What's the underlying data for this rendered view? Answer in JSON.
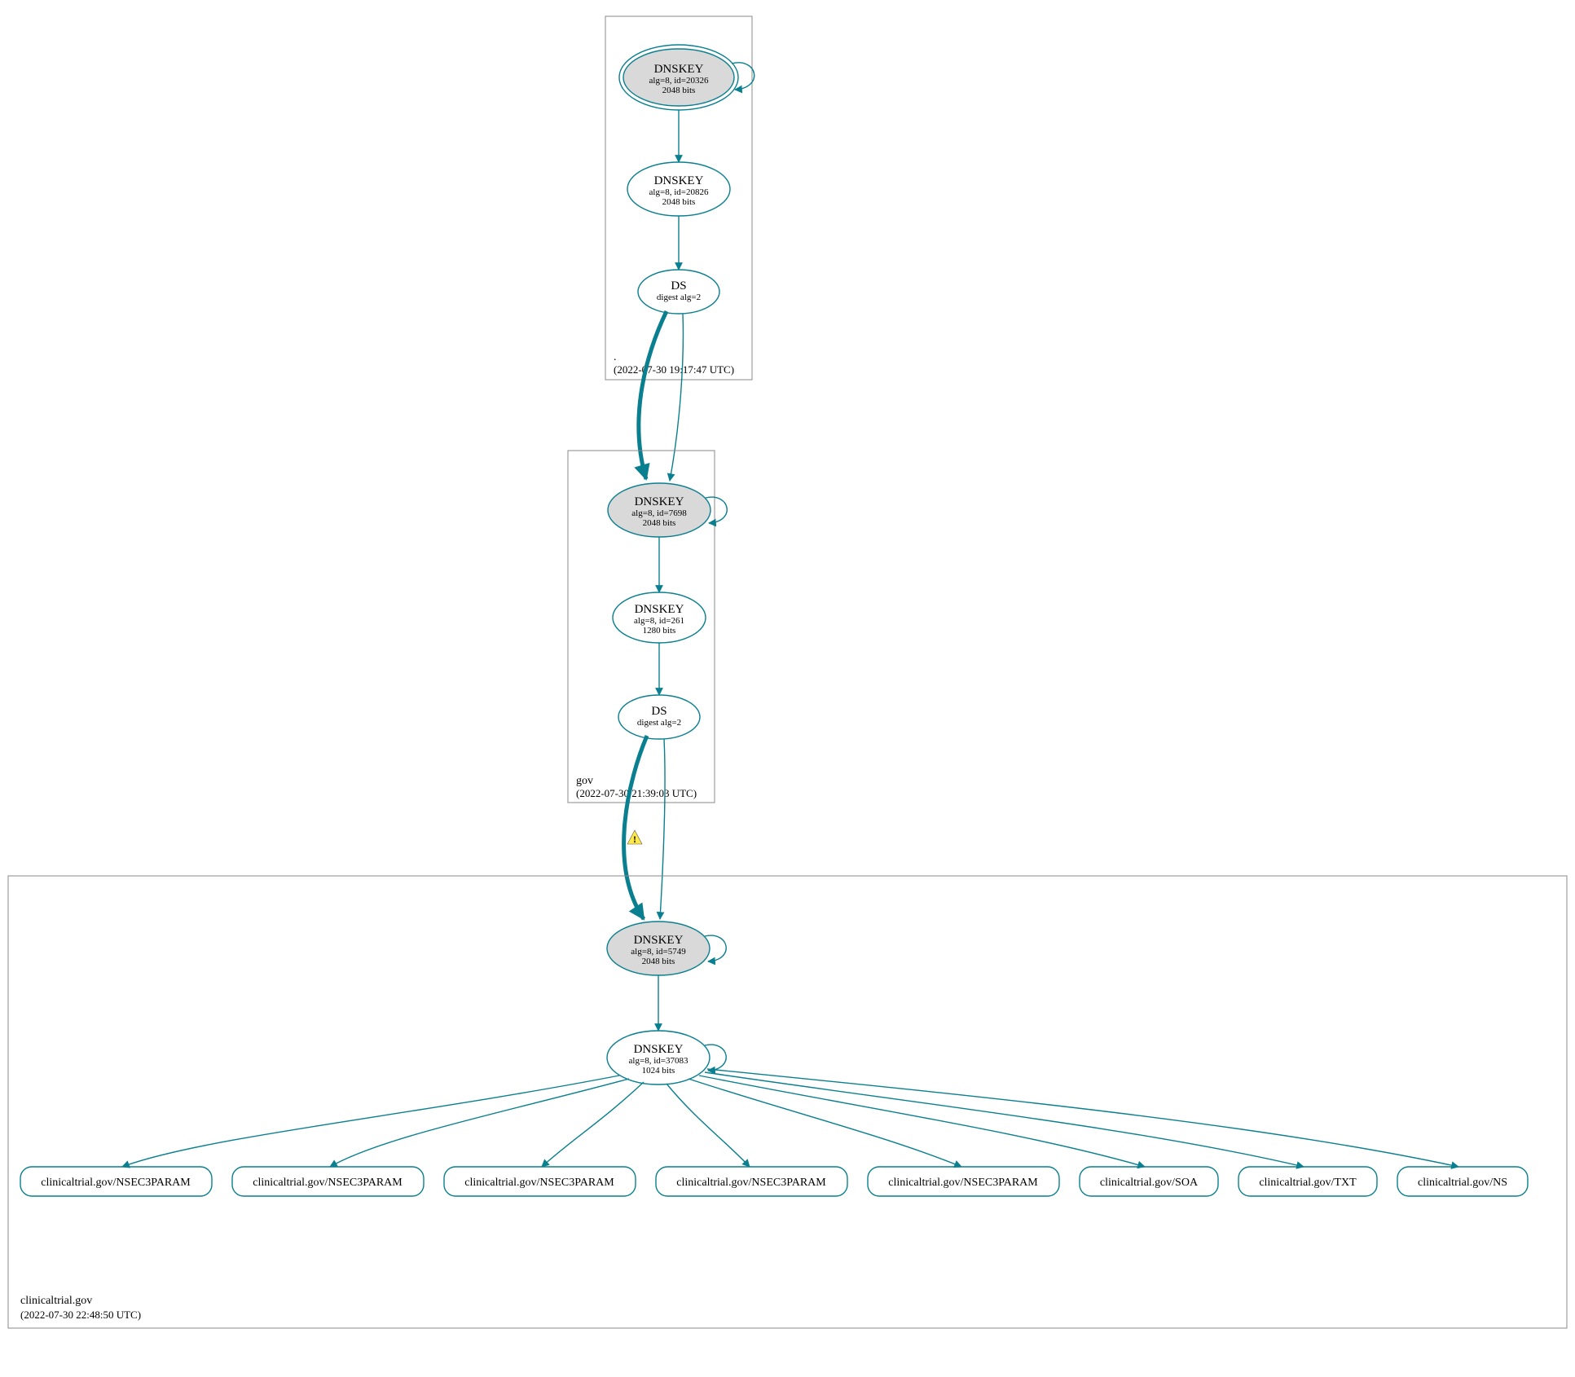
{
  "colors": {
    "teal": "#0a7f8f",
    "shaded": "#d9d9d9",
    "warn": "#ffe84a"
  },
  "zones": {
    "root": {
      "name": ".",
      "timestamp": "(2022-07-30 19:17:47 UTC)",
      "nodes": {
        "ksk": {
          "title": "DNSKEY",
          "alg": "alg=8, id=20326",
          "bits": "2048 bits",
          "shaded": true,
          "double_ring": true
        },
        "zsk": {
          "title": "DNSKEY",
          "alg": "alg=8, id=20826",
          "bits": "2048 bits"
        },
        "ds": {
          "title": "DS",
          "digest": "digest alg=2"
        }
      }
    },
    "gov": {
      "name": "gov",
      "timestamp": "(2022-07-30 21:39:03 UTC)",
      "nodes": {
        "ksk": {
          "title": "DNSKEY",
          "alg": "alg=8, id=7698",
          "bits": "2048 bits",
          "shaded": true
        },
        "zsk": {
          "title": "DNSKEY",
          "alg": "alg=8, id=261",
          "bits": "1280 bits"
        },
        "ds": {
          "title": "DS",
          "digest": "digest alg=2"
        }
      }
    },
    "clinicaltrial": {
      "name": "clinicaltrial.gov",
      "timestamp": "(2022-07-30 22:48:50 UTC)",
      "nodes": {
        "ksk": {
          "title": "DNSKEY",
          "alg": "alg=8, id=5749",
          "bits": "2048 bits",
          "shaded": true
        },
        "zsk": {
          "title": "DNSKEY",
          "alg": "alg=8, id=37083",
          "bits": "1024 bits"
        }
      },
      "rrsets": [
        "clinicaltrial.gov/NSEC3PARAM",
        "clinicaltrial.gov/NSEC3PARAM",
        "clinicaltrial.gov/NSEC3PARAM",
        "clinicaltrial.gov/NSEC3PARAM",
        "clinicaltrial.gov/NSEC3PARAM",
        "clinicaltrial.gov/SOA",
        "clinicaltrial.gov/TXT",
        "clinicaltrial.gov/NS"
      ]
    }
  },
  "icons": {
    "warning": "warning-icon"
  }
}
